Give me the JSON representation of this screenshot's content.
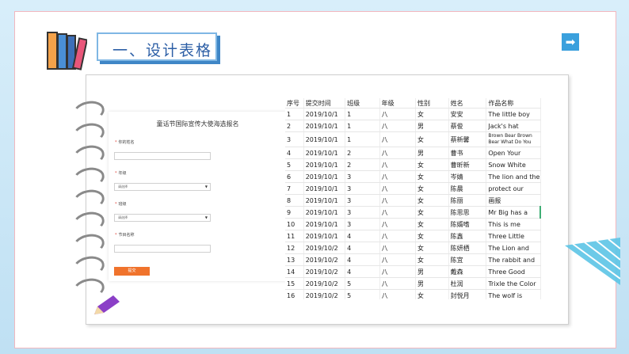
{
  "title": "一、设计表格",
  "next_icon": "right-arrow-icon",
  "form": {
    "title": "童话节国际宣传大使海选报名",
    "fields": [
      {
        "label": "你的姓名",
        "type": "input"
      },
      {
        "label": "年级",
        "type": "select",
        "placeholder": "请选择"
      },
      {
        "label": "班级",
        "type": "select",
        "placeholder": "请选择"
      },
      {
        "label": "节目名称",
        "type": "input"
      }
    ],
    "submit": "提交"
  },
  "sheet": {
    "headers": [
      "序号",
      "提交时间",
      "班级",
      "年级",
      "性别",
      "姓名",
      "作品名称"
    ],
    "rows": [
      [
        "1",
        "2019/10/1",
        "1",
        "八",
        "女",
        "安安",
        "The little boy"
      ],
      [
        "2",
        "2019/10/1",
        "1",
        "八",
        "男",
        "蔡俊",
        "Jack's hat"
      ],
      [
        "3",
        "2019/10/1",
        "1",
        "八",
        "女",
        "蔡新馨",
        "Brown Bear Brown Bear What Do You"
      ],
      [
        "4",
        "2019/10/1",
        "2",
        "八",
        "男",
        "曹书",
        "Open Your"
      ],
      [
        "5",
        "2019/10/1",
        "2",
        "八",
        "女",
        "曹昕新",
        "Snow  White"
      ],
      [
        "6",
        "2019/10/1",
        "3",
        "八",
        "女",
        "岑婧",
        "The lion and the"
      ],
      [
        "7",
        "2019/10/1",
        "3",
        "八",
        "女",
        "陈晨",
        "protect our"
      ],
      [
        "8",
        "2019/10/1",
        "3",
        "八",
        "女",
        "陈丽",
        "画报"
      ],
      [
        "9",
        "2019/10/1",
        "3",
        "八",
        "女",
        "陈思思",
        "Mr Big has a"
      ],
      [
        "10",
        "2019/10/1",
        "3",
        "八",
        "女",
        "陈婿嗜",
        "This is me"
      ],
      [
        "11",
        "2019/10/1",
        "4",
        "八",
        "女",
        "陈鑫",
        "Three Little"
      ],
      [
        "12",
        "2019/10/2",
        "4",
        "八",
        "女",
        "陈妍栖",
        "The Lion and"
      ],
      [
        "13",
        "2019/10/2",
        "4",
        "八",
        "女",
        "陈宜",
        "The rabbit and"
      ],
      [
        "14",
        "2019/10/2",
        "4",
        "八",
        "男",
        "戴森",
        "Three Good"
      ],
      [
        "15",
        "2019/10/2",
        "5",
        "八",
        "男",
        "杜润",
        "Trixle the Color"
      ],
      [
        "16",
        "2019/10/2",
        "5",
        "八",
        "女",
        "封悦月",
        "The wolf is"
      ]
    ]
  },
  "accent": "#3aa0dd",
  "submit_color": "#f0732c"
}
